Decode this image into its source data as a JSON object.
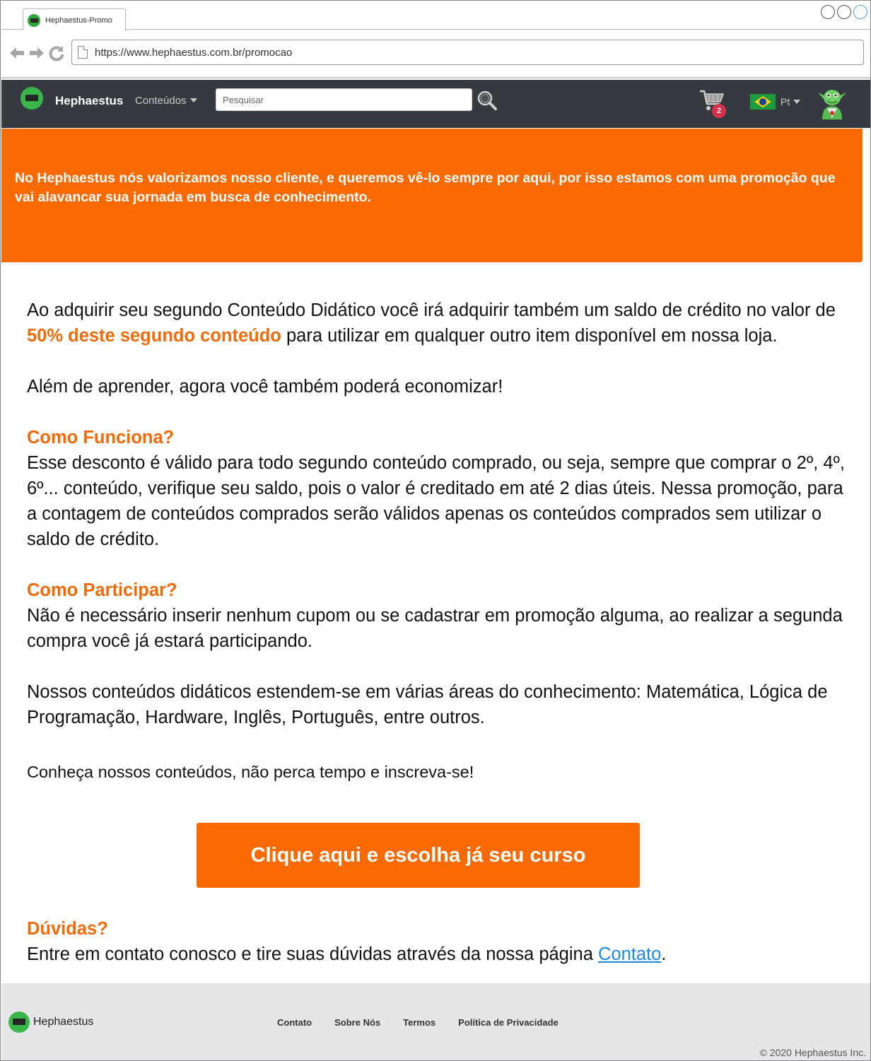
{
  "browser": {
    "tab_title": "Hephaestus-Promo",
    "url": "https://www.hephaestus.com.br/promocao"
  },
  "navbar": {
    "brand": "Hephaestus",
    "menu_label": "Conteúdos",
    "search_placeholder": "Pesquisar",
    "cart_count": "2",
    "language": "Pt"
  },
  "banner": {
    "text": "No Hephaestus nós valorizamos nosso cliente, e queremos vê-lo sempre por aqui, por isso estamos com uma promoção que vai alavancar sua jornada em busca de conhecimento."
  },
  "content": {
    "intro_before": "Ao adquirir seu segundo Conteúdo Didático você irá adquirir também um saldo de crédito no valor de ",
    "intro_highlight": "50% deste segundo conteúdo",
    "intro_after": " para utilizar em qualquer outro item disponível em nossa loja.",
    "save_line": "Além de aprender, agora você também poderá economizar!",
    "how_title": "Como Funciona?",
    "how_text": "Esse desconto é válido para todo segundo conteúdo comprado, ou seja, sempre que comprar o 2º, 4º, 6º... conteúdo, verifique seu saldo, pois o valor é creditado em até 2 dias úteis. Nessa promoção, para a contagem de conteúdos comprados serão válidos apenas os conteúdos comprados sem utilizar o saldo de crédito.",
    "join_title": "Como Participar?",
    "join_text": "Não é necessário inserir nenhum cupom ou se cadastrar em promoção alguma, ao realizar a segunda compra você já estará participando.",
    "areas_text": "Nossos conteúdos didáticos estendem-se em várias áreas do conhecimento: Matemática, Lógica de Programação, Hardware, Inglês, Português, entre outros.",
    "cta_intro": "Conheça nossos conteúdos, não perca tempo e inscreva-se!",
    "cta_button": "Clique aqui e escolha já seu curso",
    "faq_title": "Dúvidas?",
    "faq_text": "Entre em contato conosco e tire suas dúvidas através da nossa página ",
    "faq_link": "Contato",
    "faq_end": "."
  },
  "footer": {
    "brand": "Hephaestus",
    "links": [
      "Contato",
      "Sobre Nós",
      "Termos",
      "Política de Privacidade"
    ],
    "copyright": "© 2020 Hephaestus Inc."
  },
  "colors": {
    "accent": "#fa6a02",
    "navbar_bg": "#353a40",
    "footer_bg": "#e6e6e9",
    "link": "#1e88e5"
  },
  "icons": [
    "back-arrow-icon",
    "forward-arrow-icon",
    "reload-icon",
    "page-icon",
    "search-icon",
    "cart-icon",
    "brazil-flag-icon",
    "goblin-avatar-icon",
    "hephaestus-logo-icon"
  ]
}
